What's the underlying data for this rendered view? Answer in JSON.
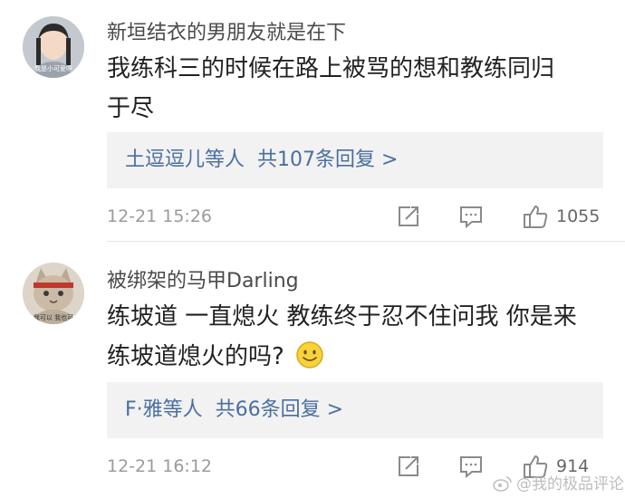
{
  "comments": [
    {
      "username": "新垣结衣的男朋友就是在下",
      "content_lines": [
        "我练科三的时候在路上被骂的想和教练同归",
        "于尽"
      ],
      "avatar_caption": "我是小可爱呀",
      "replies": {
        "names": "土逗逗儿",
        "others": "等人",
        "count_text": "共107条回复 >"
      },
      "time": "12-21 15:26",
      "likes": "1055"
    },
    {
      "username": "被绑架的马甲Darling",
      "content_lines": [
        "练坡道 一直熄火 教练终于忍不住问我 你是来",
        "练坡道熄火的吗?"
      ],
      "content_emoji": "smile-emoji",
      "avatar_caption": "我可以 我也可",
      "replies": {
        "names": "F·雅",
        "others": "等人",
        "count_text": "共66条回复 >"
      },
      "time": "12-21 16:12",
      "likes": "914"
    }
  ],
  "watermark": "@我的极品评论",
  "colors": {
    "link": "#4a6fa0",
    "reply_bg": "#f2f2f2",
    "muted": "#9b9b9b"
  }
}
